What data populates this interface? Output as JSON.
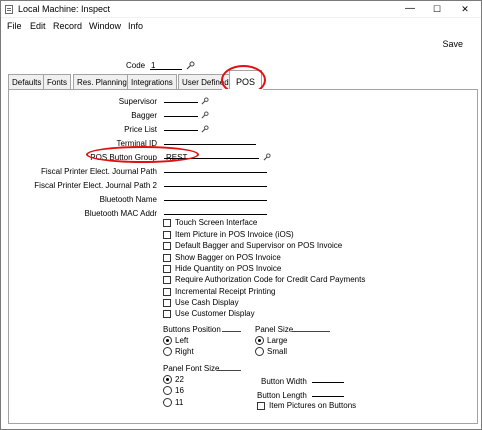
{
  "window": {
    "title": "Local Machine: Inspect",
    "minimize": "—",
    "maximize": "☐",
    "close": "✕"
  },
  "menu": [
    "File",
    "Edit",
    "Record",
    "Window",
    "Info"
  ],
  "toolbar": {
    "save_label": "Save"
  },
  "code": {
    "label": "Code",
    "value": "1"
  },
  "tabs": [
    "Defaults",
    "Fonts",
    "Res. Planning",
    "Integrations",
    "User Defined",
    "POS"
  ],
  "active_tab": "POS",
  "fields": {
    "supervisor": {
      "label": "Supervisor",
      "value": ""
    },
    "bagger": {
      "label": "Bagger",
      "value": ""
    },
    "price_list": {
      "label": "Price List",
      "value": ""
    },
    "terminal_id": {
      "label": "Terminal ID",
      "value": ""
    },
    "pos_button_group": {
      "label": "POS Button Group",
      "value": "REST"
    },
    "fiscal_path1": {
      "label": "Fiscal Printer Elect. Journal Path",
      "value": ""
    },
    "fiscal_path2": {
      "label": "Fiscal Printer Elect. Journal Path 2",
      "value": ""
    },
    "bluetooth_name": {
      "label": "Bluetooth Name",
      "value": ""
    },
    "bluetooth_mac": {
      "label": "Bluetooth MAC Addr",
      "value": ""
    }
  },
  "checkboxes": [
    {
      "label": "Touch Screen Interface",
      "checked": false
    },
    {
      "label": "Item Picture in POS Invoice (iOS)",
      "checked": false
    },
    {
      "label": "Default Bagger and Supervisor on POS Invoice",
      "checked": false
    },
    {
      "label": "Show Bagger on POS Invoice",
      "checked": false
    },
    {
      "label": "Hide Quantity on POS Invoice",
      "checked": false
    },
    {
      "label": "Require Authorization Code for Credit Card Payments",
      "checked": false
    },
    {
      "label": "Incremental Receipt Printing",
      "checked": false
    },
    {
      "label": "Use Cash Display",
      "checked": false
    },
    {
      "label": "Use Customer Display",
      "checked": false
    }
  ],
  "buttons_position": {
    "title": "Buttons Position",
    "options": [
      {
        "label": "Left",
        "selected": true
      },
      {
        "label": "Right",
        "selected": false
      }
    ]
  },
  "panel_size": {
    "title": "Panel Size",
    "options": [
      {
        "label": "Large",
        "selected": true
      },
      {
        "label": "Small",
        "selected": false
      }
    ]
  },
  "panel_font_size": {
    "title": "Panel Font Size",
    "options": [
      {
        "label": "22",
        "selected": true
      },
      {
        "label": "16",
        "selected": false
      },
      {
        "label": "11",
        "selected": false
      }
    ]
  },
  "button_width": {
    "label": "Button Width",
    "value": ""
  },
  "button_length": {
    "label": "Button Length",
    "value": ""
  },
  "item_pictures_on_buttons": {
    "label": "Item Pictures on Buttons",
    "checked": false
  },
  "colors": {
    "highlight_oval": "#e01010",
    "desktop": "#5f9ad2"
  }
}
